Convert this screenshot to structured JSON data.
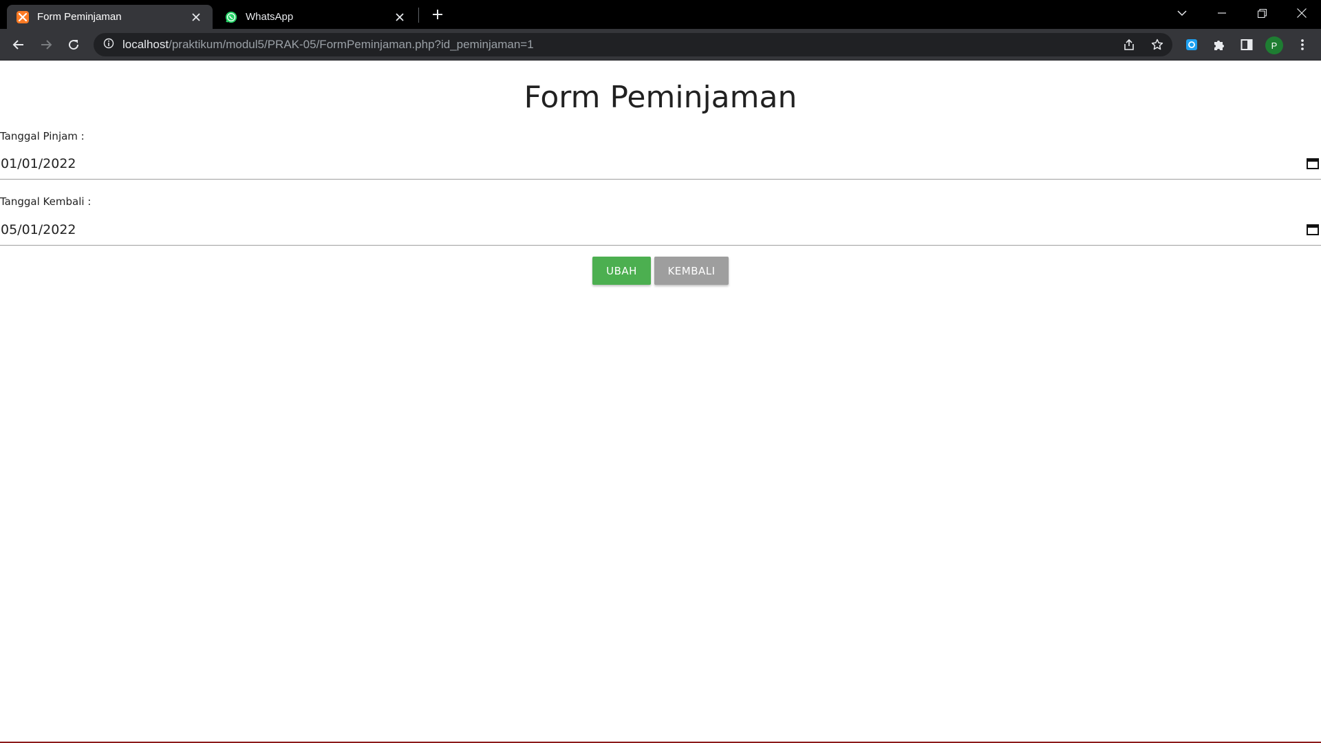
{
  "browser": {
    "tabs": [
      {
        "title": "Form Peminjaman",
        "favicon": "xampp-icon",
        "active": true
      },
      {
        "title": "WhatsApp",
        "favicon": "whatsapp-icon",
        "active": false
      }
    ],
    "url_host": "localhost",
    "url_path": "/praktikum/modul5/PRAK-05/FormPeminjaman.php?id_peminjaman=1",
    "profile_initial": "P"
  },
  "form": {
    "title": "Form Peminjaman",
    "tanggal_pinjam_label": "Tanggal Pinjam :",
    "tanggal_pinjam_value": "01/01/2022",
    "tanggal_kembali_label": "Tanggal Kembali :",
    "tanggal_kembali_value": "05/01/2022",
    "ubah_label": "UBAH",
    "kembali_label": "KEMBALI"
  },
  "colors": {
    "ubah_button": "#4caf50",
    "kembali_button": "#9e9e9e",
    "tab_active": "#35363a",
    "tabstrip": "#000000"
  }
}
